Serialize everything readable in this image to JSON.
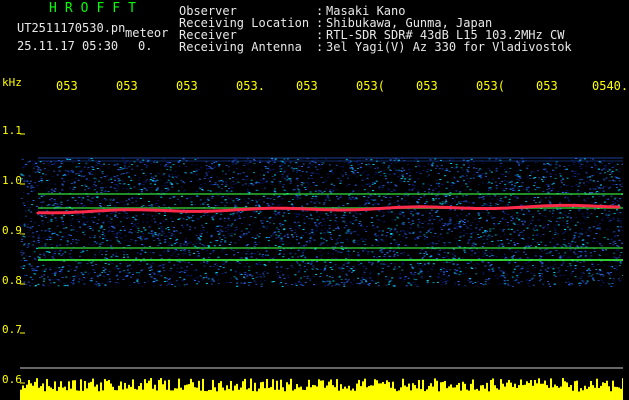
{
  "header": {
    "app_name": "HROFFT",
    "file_name": "UT2511170530.pn",
    "tag": "meteor",
    "date_time": "25.11.17 05:30",
    "extra": "0.",
    "fields": [
      {
        "label": "Observer",
        "value": "Masaki Kano"
      },
      {
        "label": "Receiving Location",
        "value": "Shibukawa, Gunma, Japan"
      },
      {
        "label": "Receiver",
        "value": "RTL-SDR SDR# 43dB L15 103.2MHz CW"
      },
      {
        "label": "Receiving Antenna",
        "value": "3el Yagi(V) Az 330 for Vladivostok"
      }
    ],
    "separator": ":"
  },
  "spectrogram": {
    "y_unit": "kHz",
    "y_ticks": [
      "1.1",
      "1.0",
      "0.9",
      "0.8",
      "0.7",
      "0.6"
    ],
    "x_ticks": [
      "053",
      "053",
      "053",
      "053",
      "053",
      "053",
      "053",
      "053",
      "053",
      "0540"
    ],
    "x_tick_suffixes": [
      "",
      "",
      "",
      ".",
      "",
      "(",
      "",
      "(",
      "",
      "."
    ],
    "colors": {
      "background": "#000000",
      "label": "#ffff00",
      "noise_low": "#0a1a7a",
      "noise_mid": "#2f6cff",
      "noise_high": "#00e0ff",
      "line_green": "#3cff3c",
      "signal_red": "#ff2a4a",
      "level_bars": "#ffff00",
      "header_text": "#e8e8e8",
      "app_name": "#00ff00"
    }
  }
}
